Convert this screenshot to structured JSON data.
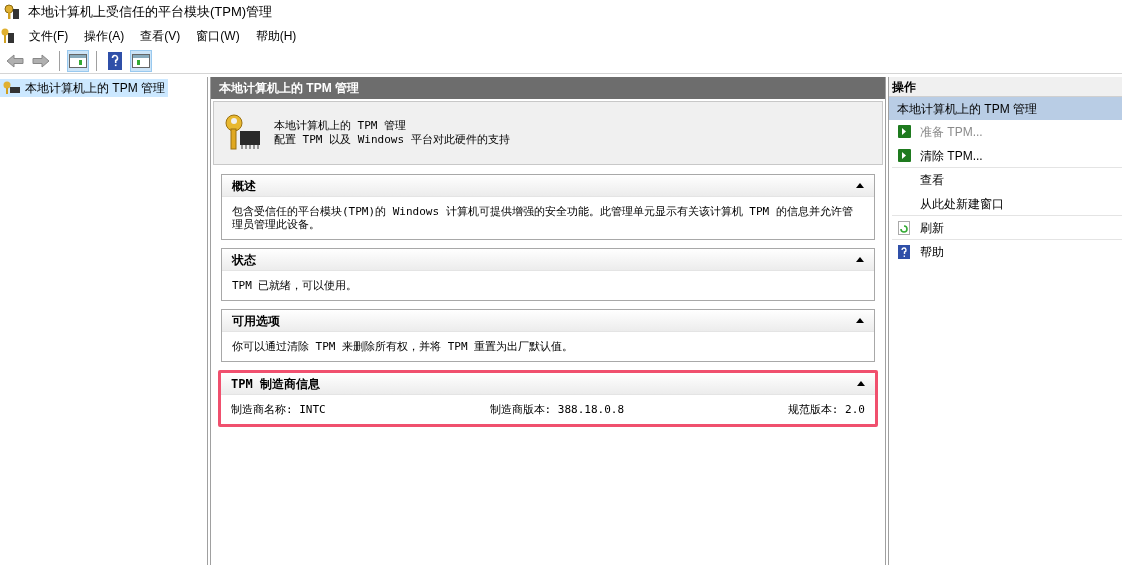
{
  "window": {
    "title": "本地计算机上受信任的平台模块(TPM)管理"
  },
  "menu": [
    "文件(F)",
    "操作(A)",
    "查看(V)",
    "窗口(W)",
    "帮助(H)"
  ],
  "toolbar": [
    {
      "kind": "back",
      "disabled": true
    },
    {
      "kind": "forward",
      "disabled": true
    },
    {
      "kind": "sep"
    },
    {
      "kind": "tree",
      "pressed": true
    },
    {
      "kind": "sep"
    },
    {
      "kind": "help",
      "pressed": false
    },
    {
      "kind": "actions",
      "pressed": true
    }
  ],
  "tree": [
    {
      "label": "本地计算机上的 TPM 管理",
      "selected": true
    }
  ],
  "main": {
    "header": "本地计算机上的 TPM 管理",
    "intro_title": "本地计算机上的 TPM 管理",
    "intro_subtitle": "配置 TPM 以及 Windows 平台对此硬件的支持",
    "sections": [
      {
        "title": "概述",
        "expanded": true,
        "highlighted": false,
        "kind": "text",
        "text": "包含受信任的平台模块(TPM)的 Windows 计算机可提供增强的安全功能。此管理单元显示有关该计算机 TPM 的信息并允许管理员管理此设备。"
      },
      {
        "title": "状态",
        "expanded": true,
        "highlighted": false,
        "kind": "text",
        "text": "TPM 已就绪，可以使用。"
      },
      {
        "title": "可用选项",
        "expanded": true,
        "highlighted": false,
        "kind": "text",
        "text": "你可以通过清除 TPM 来删除所有权，并将 TPM 重置为出厂默认值。"
      },
      {
        "title": "TPM 制造商信息",
        "expanded": true,
        "highlighted": true,
        "kind": "fields",
        "fields": [
          "制造商名称: INTC",
          "制造商版本: 388.18.0.8",
          "规范版本: 2.0"
        ]
      }
    ]
  },
  "actions": {
    "header": "操作",
    "group": "本地计算机上的 TPM 管理",
    "items": [
      {
        "label": "准备 TPM...",
        "kind": "arrow",
        "disabled": true,
        "divider_after": false
      },
      {
        "label": "清除 TPM...",
        "kind": "arrow",
        "disabled": false,
        "divider_after": true
      },
      {
        "label": "查看",
        "kind": "none",
        "disabled": false,
        "divider_after": false
      },
      {
        "label": "从此处新建窗口",
        "kind": "none",
        "disabled": false,
        "divider_after": true
      },
      {
        "label": "刷新",
        "kind": "refresh",
        "disabled": false,
        "divider_after": true
      },
      {
        "label": "帮助",
        "kind": "help",
        "disabled": false,
        "divider_after": false
      }
    ]
  }
}
